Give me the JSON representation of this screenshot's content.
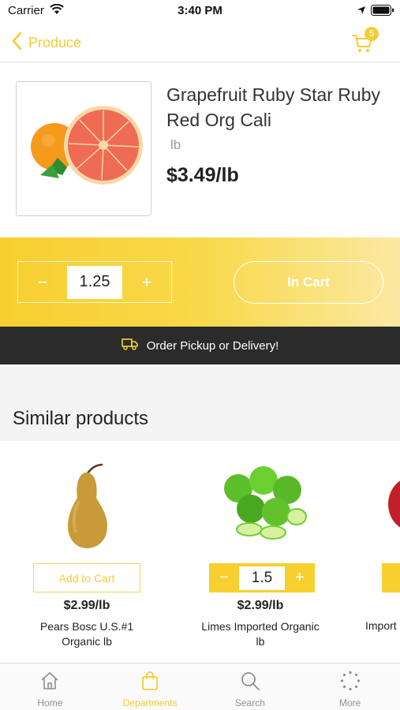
{
  "status_bar": {
    "carrier": "Carrier",
    "time": "3:40 PM"
  },
  "nav": {
    "back_label": "Produce",
    "cart_count": "5"
  },
  "product": {
    "name": "Grapefruit Ruby Star Ruby Red Org Cali",
    "unit": "lb",
    "price": "$3.49/lb",
    "quantity": "1.25",
    "in_cart_label": "In Cart",
    "minus": "−",
    "plus": "+"
  },
  "banner": {
    "text": "Order Pickup or Delivery!"
  },
  "similar": {
    "title": "Similar products",
    "items": [
      {
        "name": "Pears Bosc U.S.#1 Organic lb",
        "price": "$2.99/lb",
        "action": "Add to Cart"
      },
      {
        "name": "Limes Imported Organic lb",
        "price": "$2.99/lb",
        "quantity": "1.5"
      },
      {
        "name": "Import"
      }
    ]
  },
  "tabs": [
    {
      "label": "Home",
      "active": false
    },
    {
      "label": "Departments",
      "active": true
    },
    {
      "label": "Search",
      "active": false
    },
    {
      "label": "More",
      "active": false
    }
  ],
  "colors": {
    "accent": "#f5cc36",
    "banner": "#2b2b2b",
    "inactive": "#8e8e8e"
  },
  "icons": [
    "wifi-icon",
    "location-icon",
    "battery-icon",
    "back-chevron-icon",
    "cart-icon",
    "truck-icon",
    "home-icon",
    "bag-icon",
    "search-icon",
    "more-dots-icon"
  ]
}
